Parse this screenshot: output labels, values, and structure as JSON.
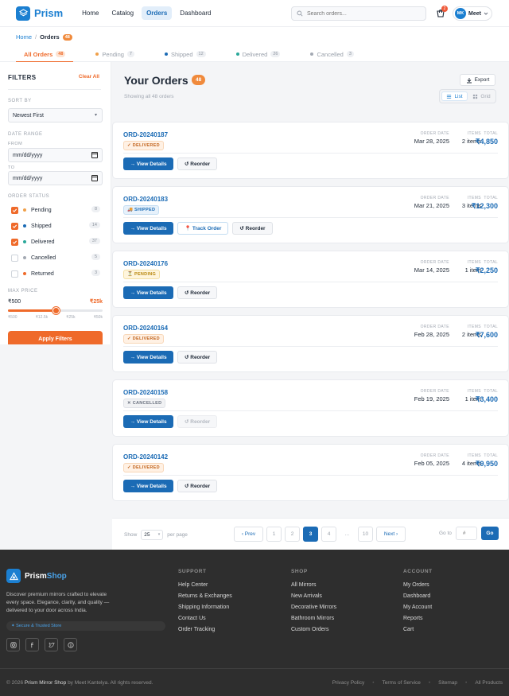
{
  "header": {
    "logo": "Prism",
    "nav": [
      "Home",
      "Catalog",
      "Orders",
      "Dashboard"
    ],
    "active_nav": "Orders",
    "search_placeholder": "Search orders...",
    "cart_count": "2",
    "user_initials": "MK",
    "user_name": "Meet"
  },
  "breadcrumb": {
    "home": "Home",
    "sep": "/",
    "current": "Orders",
    "count": "48"
  },
  "tabs": [
    {
      "label": "All Orders",
      "count": "48",
      "color": "#ef6a2a"
    },
    {
      "label": "Pending",
      "count": "7",
      "color": "#f0a04a"
    },
    {
      "label": "Shipped",
      "count": "12",
      "color": "#1b6bb5"
    },
    {
      "label": "Delivered",
      "count": "26",
      "color": "#2aa89a"
    },
    {
      "label": "Cancelled",
      "count": "3",
      "color": "#a3a9b3"
    }
  ],
  "filters": {
    "title": "FILTERS",
    "clear": "Clear All",
    "sort_label": "SORT BY",
    "sort_value": "Newest First",
    "date_label": "DATE RANGE",
    "from_label": "FROM",
    "from_value": "mm/dd/yyyy",
    "to_label": "TO",
    "to_value": "mm/dd/yyyy",
    "status_label": "ORDER STATUS",
    "statuses": [
      {
        "label": "Pending",
        "count": "8",
        "checked": true,
        "color": "#f0a04a"
      },
      {
        "label": "Shipped",
        "count": "14",
        "checked": true,
        "color": "#1b6bb5"
      },
      {
        "label": "Delivered",
        "count": "37",
        "checked": true,
        "color": "#2aa89a"
      },
      {
        "label": "Cancelled",
        "count": "5",
        "checked": false,
        "color": "#a3a9b3"
      },
      {
        "label": "Returned",
        "count": "3",
        "checked": false,
        "color": "#ef6a2a"
      }
    ],
    "price_label": "MAX PRICE",
    "price_min": "₹500",
    "price_max": "₹25k",
    "price_fraction": 0.5,
    "ticks": [
      "₹500",
      "₹12.5k",
      "₹25k",
      "₹50k"
    ],
    "apply": "Apply Filters"
  },
  "main": {
    "title": "Your Orders",
    "count": "48",
    "showing": "Showing all 48 orders",
    "export": "Export",
    "view_list": "List",
    "view_grid": "Grid"
  },
  "labels": {
    "order_date": "ORDER DATE",
    "items": "ITEMS",
    "total": "TOTAL",
    "view_details": "→ View Details"
  },
  "orders": [
    {
      "id": "ORD-20240187",
      "status": "✓ DELIVERED",
      "status_class": "st-delivered",
      "date": "Mar 28, 2025",
      "items": "2 items",
      "total": "₹4,850",
      "second": "↺ Reorder",
      "second_class": "btn-secondary",
      "third": ""
    },
    {
      "id": "ORD-20240183",
      "status": "🚚 SHIPPED",
      "status_class": "st-shipped",
      "date": "Mar 21, 2025",
      "items": "3 items",
      "total": "₹12,300",
      "second": "📍 Track Order",
      "second_class": "btn-track",
      "third": "↺ Reorder"
    },
    {
      "id": "ORD-20240176",
      "status": "⏳ PENDING",
      "status_class": "st-pending",
      "date": "Mar 14, 2025",
      "items": "1 item",
      "total": "₹2,250",
      "second": "↺ Reorder",
      "second_class": "btn-secondary",
      "third": ""
    },
    {
      "id": "ORD-20240164",
      "status": "✓ DELIVERED",
      "status_class": "st-delivered",
      "date": "Feb 28, 2025",
      "items": "2 items",
      "total": "₹7,600",
      "second": "↺ Reorder",
      "second_class": "btn-secondary",
      "third": ""
    },
    {
      "id": "ORD-20240158",
      "status": "✕ CANCELLED",
      "status_class": "st-cancelled",
      "date": "Feb 19, 2025",
      "items": "1 item",
      "total": "₹3,400",
      "second": "↺ Reorder",
      "second_class": "btn-disabled",
      "third": ""
    },
    {
      "id": "ORD-20240142",
      "status": "✓ DELIVERED",
      "status_class": "st-delivered",
      "date": "Feb 05, 2025",
      "items": "4 items",
      "total": "₹9,950",
      "second": "↺ Reorder",
      "second_class": "btn-secondary",
      "third": ""
    }
  ],
  "pagination": {
    "show": "Show",
    "per_page_value": "25",
    "per_page": "per page",
    "prev": "‹ Prev",
    "pages": [
      "1",
      "2",
      "3",
      "4",
      "...",
      "10"
    ],
    "current": "3",
    "next": "Next ›",
    "goto": "Go to",
    "goto_placeholder": "#",
    "go": "Go"
  },
  "footer": {
    "logo_a": "Prism",
    "logo_b": "Shop",
    "desc": "Discover premium mirrors crafted to elevate every space. Elegance, clarity, and quality — delivered to your door across India.",
    "trust": "✦ Secure & Trusted Store",
    "social": [
      "instagram-icon",
      "facebook-icon",
      "twitter-icon",
      "pinterest-icon"
    ],
    "cols": [
      {
        "heading": "SUPPORT",
        "links": [
          "Help Center",
          "Returns & Exchanges",
          "Shipping Information",
          "Contact Us",
          "Order Tracking"
        ]
      },
      {
        "heading": "SHOP",
        "links": [
          "All Mirrors",
          "New Arrivals",
          "Decorative Mirrors",
          "Bathroom Mirrors",
          "Custom Orders"
        ]
      },
      {
        "heading": "ACCOUNT",
        "links": [
          "My Orders",
          "Dashboard",
          "My Account",
          "Reports",
          "Cart"
        ]
      }
    ],
    "copy_a": "© 2026",
    "copy_b": "Prism Mirror Shop",
    "copy_c": "by Meet Kantelya. All rights reserved.",
    "bottom_links": [
      "Privacy Policy",
      "Terms of Service",
      "Sitemap",
      "All Products"
    ]
  }
}
